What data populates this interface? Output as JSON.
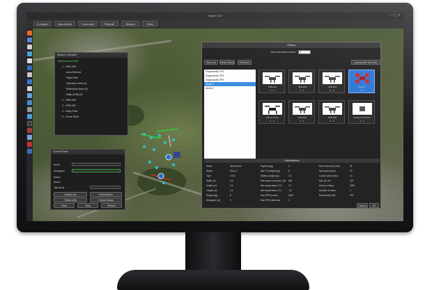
{
  "window": {
    "title": "Swarm GUI",
    "controls": "— ▢ ✕"
  },
  "menubar": {
    "items": [
      "Configure",
      "Association",
      "Command",
      "Payload",
      "Mission",
      "Tools"
    ]
  },
  "tree_panel": {
    "title": "Mission Checklist",
    "items": [
      "MissionLaunchSW",
      "1 - SPB-4R2",
      "Area Defined",
      "Flight Plan",
      "Operation Area (3)",
      "Restriction Area (3)",
      "Rally (Drift) (3)",
      "2 - SPB-4R2",
      "3 - SPB-4R2",
      "4 - Rally Point",
      "5 - Home Point"
    ]
  },
  "control_panel": {
    "title": "Control Panel",
    "labels": [
      "Mode",
      "Navigation",
      "Status",
      "Select",
      "Takeoff all"
    ],
    "buttons": [
      "Swarm Up",
      "Edit Mission",
      "Select (All)",
      "Check Status",
      "Start",
      "Stop",
      "Restart"
    ]
  },
  "dialog": {
    "title": "Dialog",
    "count_label": "Total Characters number",
    "count_value": "3",
    "toolbar": [
      "Save (A)",
      "Reset (Row)",
      "Reserve"
    ],
    "load_button": "Load profile from (A)",
    "list": [
      "Dayscandle 1FS",
      "Dayscandle 2FS",
      "Dayscandle 3FS",
      "Aerial 1",
      "Aerial 2"
    ],
    "cards": [
      {
        "caption": "SPB-4R2",
        "selected": false,
        "kind": "quad"
      },
      {
        "caption": "SPB-4R2",
        "selected": false,
        "kind": "quad"
      },
      {
        "caption": "SPB-4R2",
        "selected": false,
        "kind": "quad"
      },
      {
        "caption": "Rotor 3",
        "selected": true,
        "kind": "red"
      },
      {
        "caption": "Plan & Drone",
        "selected": false,
        "kind": "quad"
      },
      {
        "caption": "SPB-4R2",
        "selected": false,
        "kind": "quad"
      },
      {
        "caption": "SPB-4R2",
        "selected": false,
        "kind": "quad"
      },
      {
        "caption": "Rocket Test Drone",
        "selected": false,
        "kind": "tile"
      }
    ],
    "spec_title": "Specifications",
    "specs_col1": [
      [
        "Name",
        "Aerial Rotor"
      ],
      [
        "Model",
        "Rotor 2"
      ],
      [
        "Type",
        "VTOL"
      ],
      [
        "Width (m)",
        "0.5"
      ],
      [
        "Height (m)",
        "0.3"
      ],
      [
        "Length (m)",
        "0.5"
      ],
      [
        "Weight (kg)",
        "5"
      ],
      [
        "Wingspan (m)",
        "0"
      ]
    ],
    "specs_col2": [
      [
        "Payload (kg)",
        "3"
      ],
      [
        "Max TO weight (kg)",
        "8"
      ],
      [
        "Battery weight (kg)",
        "1.5"
      ],
      [
        "Max power consump. (W)",
        "800"
      ],
      [
        "Max temperature (°C)",
        "70"
      ],
      [
        "Min temperature (°C)",
        "-20"
      ],
      [
        "Max RPM (rotors)",
        "9000"
      ],
      [
        "Max RPM (ailerons)",
        "0"
      ]
    ],
    "specs_col3": [
      [
        "Max endurance (min)",
        "25"
      ],
      [
        "Max speed (m/s)",
        "15"
      ],
      [
        "Cruise speed (m/s)",
        "10"
      ],
      [
        "Max alt. (m)",
        "120"
      ],
      [
        "Service ceiling",
        "4000"
      ],
      [
        "Number of rotors",
        "4"
      ],
      [
        "Rotor power (W)",
        "200"
      ]
    ],
    "cancel": "Cancel",
    "ok": "OK"
  }
}
